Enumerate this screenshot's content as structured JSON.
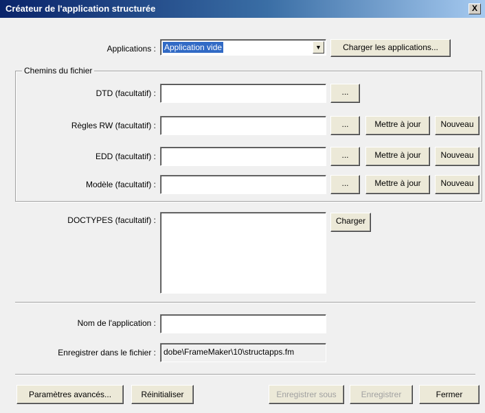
{
  "window": {
    "title": "Créateur de l'application structurée",
    "close_glyph": "X"
  },
  "applications": {
    "label": "Applications :",
    "selected": "Application vide",
    "load_button": "Charger les applications..."
  },
  "file_paths": {
    "legend": "Chemins du fichier",
    "browse_label": "...",
    "update_label": "Mettre à jour",
    "new_label": "Nouveau",
    "rows": [
      {
        "label": "DTD (facultatif) :",
        "value": ""
      },
      {
        "label": "Règles RW (facultatif) :",
        "value": ""
      },
      {
        "label": "EDD (facultatif) :",
        "value": ""
      },
      {
        "label": "Modèle (facultatif) :",
        "value": ""
      }
    ]
  },
  "doctypes": {
    "label": "DOCTYPES (facultatif) :",
    "load_button": "Charger"
  },
  "app_name": {
    "label": "Nom de l'application :",
    "value": ""
  },
  "save_file": {
    "label": "Enregistrer dans le fichier :",
    "value": "dobe\\FrameMaker\\10\\structapps.fm"
  },
  "footer": {
    "advanced": "Paramètres avancés...",
    "reset": "Réinitialiser",
    "save_as": "Enregistrer sous",
    "save": "Enregistrer",
    "close": "Fermer"
  }
}
